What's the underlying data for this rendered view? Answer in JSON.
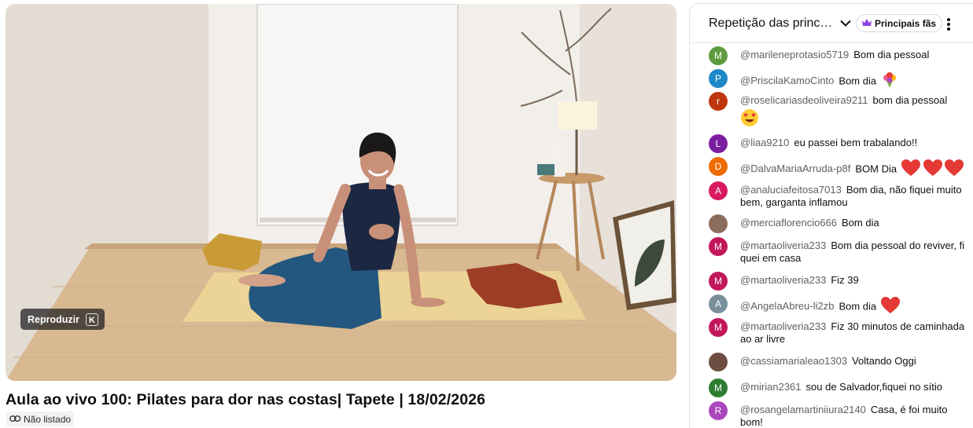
{
  "video": {
    "title": "Aula ao vivo 100: Pilates para dor nas costas| Tapete | 18/02/2026",
    "play_tooltip": "Reproduzir",
    "play_shortcut": "K",
    "visibility": "Não listado"
  },
  "chat": {
    "title": "Repetição das principais mensagens do chat",
    "filter_label": "Principais fãs",
    "messages": [
      {
        "initial": "M",
        "avatar_color": "#5f9b41",
        "author": "@marileneprotasio5719",
        "text": "Bom dia pessoal",
        "emoji": ""
      },
      {
        "initial": "P",
        "avatar_color": "#1e88c8",
        "author": "@PriscilaKamoCinto",
        "text": "Bom dia",
        "emoji": "bouquet"
      },
      {
        "initial": "r",
        "avatar_color": "#bf360c",
        "author": "@roselicariasdeoliveira9211",
        "text": "bom dia pessoal",
        "emoji": "heart-eyes"
      },
      {
        "initial": "L",
        "avatar_color": "#7b1fa2",
        "author": "@liaa9210",
        "text": "eu passei bem trabalando!!",
        "emoji": ""
      },
      {
        "initial": "D",
        "avatar_color": "#ef6c00",
        "author": "@DalvaMariaArruda-p8f",
        "text": "BOM Dia",
        "emoji": "hearts3"
      },
      {
        "initial": "A",
        "avatar_color": "#d81b60",
        "author": "@analuciafeitosa7013",
        "text": "Bom dia, não fiquei muito bem, garganta inflamou",
        "emoji": ""
      },
      {
        "initial": "",
        "avatar_color": "#8a6d5a",
        "author": "@merciaflorencio666",
        "text": "Bom dia",
        "emoji": ""
      },
      {
        "initial": "M",
        "avatar_color": "#c2185b",
        "author": "@martaoliveria233",
        "text": "Bom dia pessoal do reviver, fi quei em casa",
        "emoji": ""
      },
      {
        "initial": "M",
        "avatar_color": "#c2185b",
        "author": "@martaoliveria233",
        "text": "Fiz 39",
        "emoji": ""
      },
      {
        "initial": "A",
        "avatar_color": "#78909c",
        "author": "@AngelaAbreu-li2zb",
        "text": "Bom dia",
        "emoji": "heart"
      },
      {
        "initial": "M",
        "avatar_color": "#c2185b",
        "author": "@martaoliveria233",
        "text": "Fiz 30 minutos de caminhada ao ar livre",
        "emoji": ""
      },
      {
        "initial": "",
        "avatar_color": "#6d4c41",
        "author": "@cassiamarialeao1303",
        "text": "Voltando Oggi",
        "emoji": ""
      },
      {
        "initial": "M",
        "avatar_color": "#2e7d32",
        "author": "@mirian2361",
        "text": "sou de Salvador,fiquei no sítio",
        "emoji": ""
      },
      {
        "initial": "R",
        "avatar_color": "#ab47bc",
        "author": "@rosangelamartiniiura2140",
        "text": "Casa, é foi muito bom!",
        "emoji": ""
      }
    ]
  }
}
